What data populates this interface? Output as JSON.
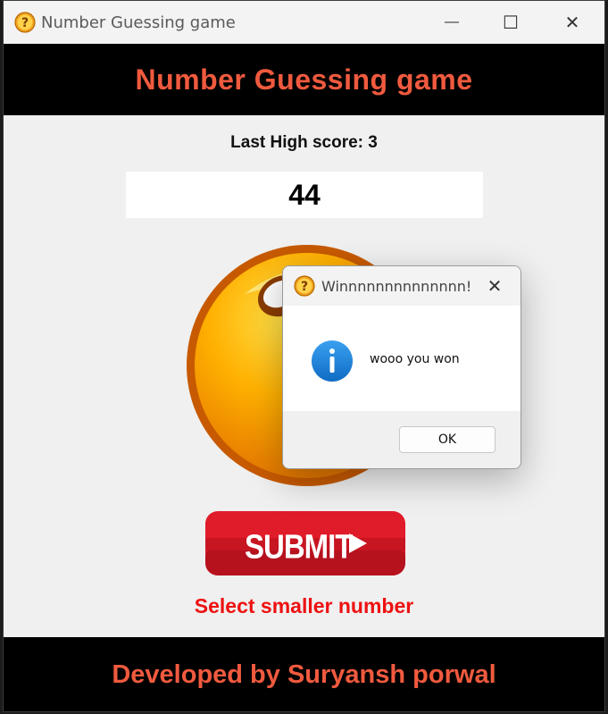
{
  "window": {
    "title": "Number Guessing game",
    "controls": {
      "minimize": "—",
      "maximize": "☐",
      "close": "✕"
    }
  },
  "header": {
    "title": "Number Guessing game"
  },
  "score": {
    "text": "Last High score: 3"
  },
  "guess_input": {
    "value": "44"
  },
  "submit_button": {
    "label": "SUBMIT"
  },
  "hint": {
    "text": "Select smaller number"
  },
  "footer": {
    "text": "Developed by Suryansh porwal"
  },
  "dialog": {
    "title": "Winnnnnnnnnnnnnn!",
    "message": "wooo you won",
    "ok_label": "OK",
    "close_glyph": "✕",
    "icon": "info-icon"
  },
  "colors": {
    "accent_text": "#f05a3e",
    "hint_text": "#ee1111",
    "submit_red": "#d71a26",
    "info_blue": "#1a7fd4"
  }
}
